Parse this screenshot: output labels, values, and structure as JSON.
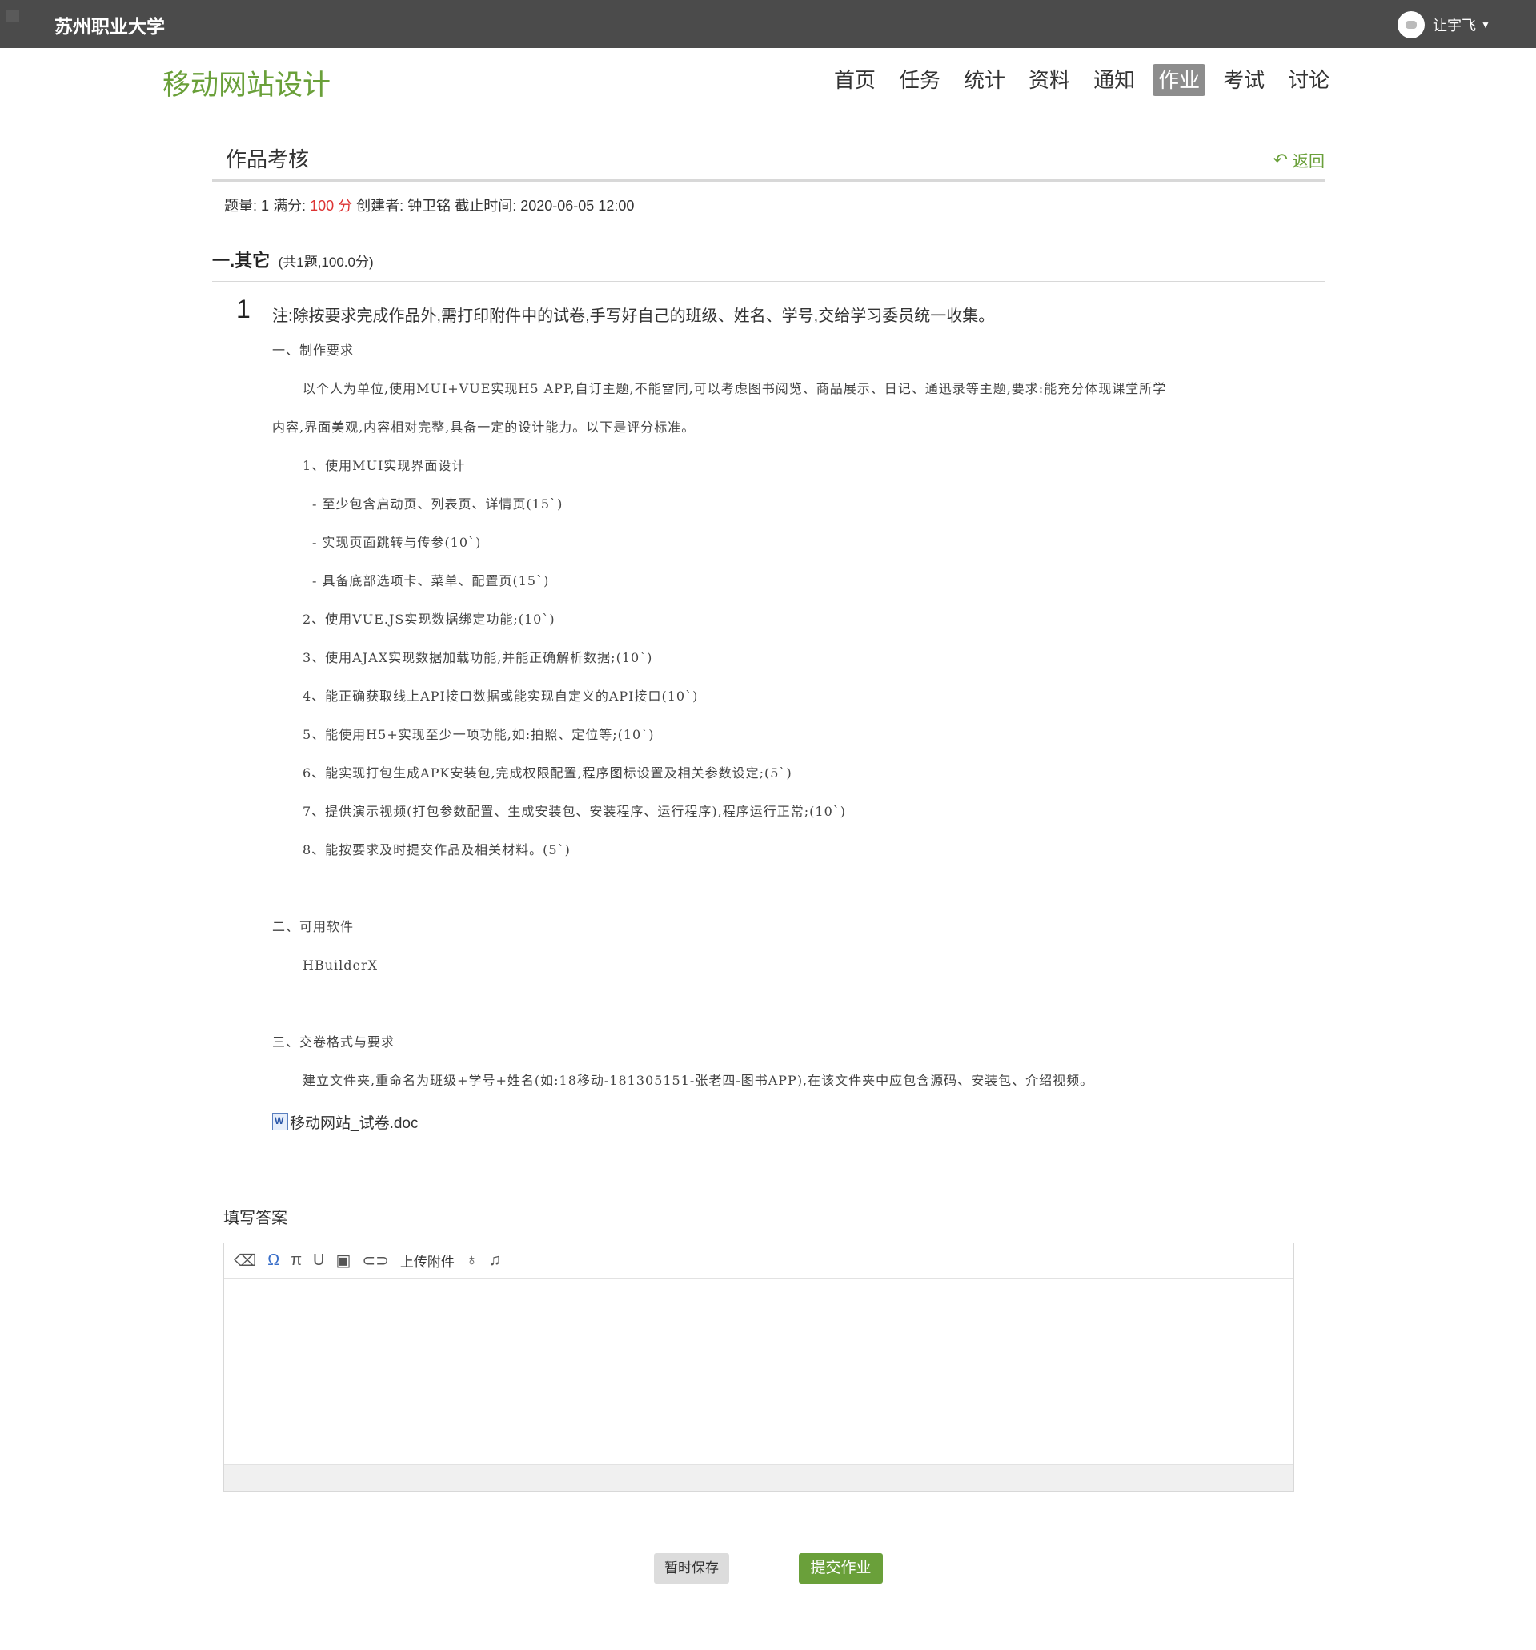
{
  "topbar": {
    "school": "苏州职业大学",
    "user_name": "让宇飞"
  },
  "course": {
    "title": "移动网站设计",
    "nav": [
      {
        "label": "首页",
        "active": false
      },
      {
        "label": "任务",
        "active": false
      },
      {
        "label": "统计",
        "active": false
      },
      {
        "label": "资料",
        "active": false
      },
      {
        "label": "通知",
        "active": false
      },
      {
        "label": "作业",
        "active": true
      },
      {
        "label": "考试",
        "active": false
      },
      {
        "label": "讨论",
        "active": false
      }
    ]
  },
  "assignment": {
    "title": "作品考核",
    "back_label": "返回",
    "meta": {
      "count_label": "题量:",
      "count": "1",
      "full_label": "满分:",
      "score": "100 分",
      "creator_label": "创建者:",
      "creator": "钟卫铭",
      "deadline_label": "截止时间:",
      "deadline": "2020-06-05 12:00"
    },
    "section": {
      "title": "一.其它",
      "summary": "(共1题,100.0分)"
    },
    "question": {
      "number": "1",
      "note": "注:除按要求完成作品外,需打印附件中的试卷,手写好自己的班级、姓名、学号,交给学习委员统一收集。",
      "lines": [
        {
          "text": "一、制作要求",
          "indent": 0
        },
        {
          "text": "以个人为单位,使用MUI+VUE实现H5 APP,自订主题,不能雷同,可以考虑图书阅览、商品展示、日记、通迅录等主题,要求:能充分体现课堂所学",
          "indent": 1
        },
        {
          "text": "内容,界面美观,内容相对完整,具备一定的设计能力。以下是评分标准。",
          "indent": 0
        },
        {
          "text": "1、使用MUI实现界面设计",
          "indent": 1
        },
        {
          "text": "- 至少包含启动页、列表页、详情页(15`)",
          "indent": 2
        },
        {
          "text": "- 实现页面跳转与传参(10`)",
          "indent": 2
        },
        {
          "text": "- 具备底部选项卡、菜单、配置页(15`)",
          "indent": 2
        },
        {
          "text": "2、使用VUE.JS实现数据绑定功能;(10`)",
          "indent": 1
        },
        {
          "text": "3、使用AJAX实现数据加载功能,并能正确解析数据;(10`)",
          "indent": 1
        },
        {
          "text": "4、能正确获取线上API接口数据或能实现自定义的API接口(10`)",
          "indent": 1
        },
        {
          "text": "5、能使用H5+实现至少一项功能,如:拍照、定位等;(10`)",
          "indent": 1
        },
        {
          "text": "6、能实现打包生成APK安装包,完成权限配置,程序图标设置及相关参数设定;(5`)",
          "indent": 1
        },
        {
          "text": "7、提供演示视频(打包参数配置、生成安装包、安装程序、运行程序),程序运行正常;(10`)",
          "indent": 1
        },
        {
          "text": "8、能按要求及时提交作品及相关材料。(5`)",
          "indent": 1
        },
        {
          "text": "",
          "indent": 0
        },
        {
          "text": "二、可用软件",
          "indent": 0
        },
        {
          "text": "HBuilderX",
          "indent": 1
        },
        {
          "text": "",
          "indent": 0
        },
        {
          "text": "三、交卷格式与要求",
          "indent": 0
        },
        {
          "text": "建立文件夹,重命名为班级+学号+姓名(如:18移动-181305151-张老四-图书APP),在该文件夹中应包含源码、安装包、介绍视频。",
          "indent": 1
        }
      ],
      "attachment": "移动网站_试卷.doc"
    },
    "answer": {
      "label": "填写答案",
      "toolbar": [
        {
          "icon": "eraser-icon",
          "glyph": "⌫",
          "blue": false
        },
        {
          "icon": "omega-icon",
          "glyph": "Ω",
          "blue": true
        },
        {
          "icon": "pi-icon",
          "glyph": "π",
          "blue": false
        },
        {
          "icon": "underline-icon",
          "glyph": "U",
          "blue": false
        },
        {
          "icon": "image-icon",
          "glyph": "▣",
          "blue": false
        },
        {
          "icon": "link-icon",
          "glyph": "⊂⊃",
          "blue": false
        },
        {
          "icon": "upload-icon",
          "glyph": "上传附件",
          "blue": false
        },
        {
          "icon": "microphone-icon",
          "glyph": "♁",
          "blue": false
        },
        {
          "icon": "music-icon",
          "glyph": "♫",
          "blue": false
        }
      ]
    },
    "buttons": {
      "save": "暂时保存",
      "submit": "提交作业"
    }
  }
}
